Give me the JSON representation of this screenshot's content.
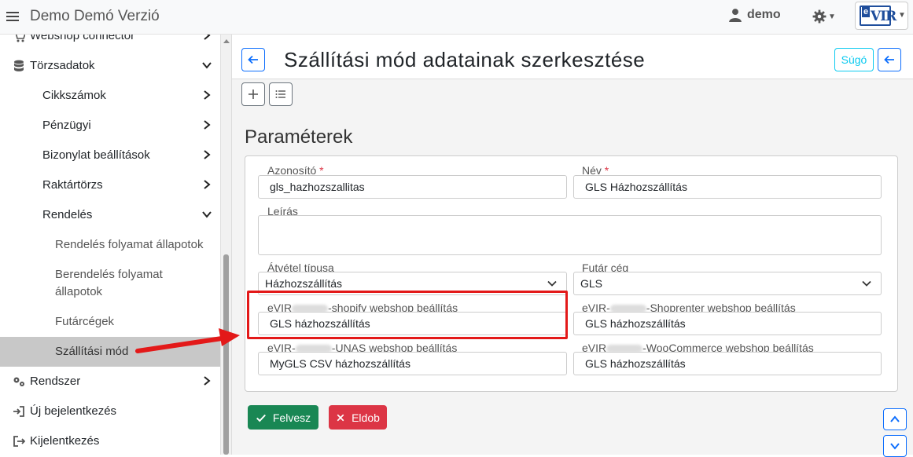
{
  "app": {
    "title": "Demo Demó Verzió"
  },
  "topbar": {
    "user": "demo",
    "logo": {
      "e": "e",
      "vir": "VIR"
    }
  },
  "sidebar": {
    "items": [
      {
        "label": "Webshop connector"
      },
      {
        "label": "Törzsadatok"
      },
      {
        "label": "Cikkszámok"
      },
      {
        "label": "Pénzügyi"
      },
      {
        "label": "Bizonylat beállítások"
      },
      {
        "label": "Raktártörzs"
      },
      {
        "label": "Rendelés"
      },
      {
        "label": "Rendelés folyamat állapotok"
      },
      {
        "label": "Berendelés folyamat állapotok"
      },
      {
        "label": "Futárcégek"
      },
      {
        "label": "Szállítási mód"
      },
      {
        "label": "Rendszer"
      },
      {
        "label": "Új bejelentkezés"
      },
      {
        "label": "Kijelentkezés"
      }
    ]
  },
  "header": {
    "title": "Szállítási mód adatainak szerkesztése",
    "help_label": "Súgó"
  },
  "section": {
    "title": "Paraméterek"
  },
  "form": {
    "azonosito": {
      "label": "Azonosító",
      "required": "*",
      "value": "gls_hazhozszallitas"
    },
    "nev": {
      "label": "Név",
      "required": "*",
      "value": "GLS Házhozszállítás"
    },
    "leiras": {
      "label": "Leírás",
      "value": ""
    },
    "atvetel": {
      "label": "Átvétel típusa",
      "value": "Házhozszállítás"
    },
    "futar": {
      "label": "Futár cég",
      "value": "GLS"
    },
    "shopify": {
      "label_prefix": "eVIR",
      "label_suffix": "-shopify webshop beállítás",
      "value": "GLS házhozszállítás"
    },
    "shoprenter": {
      "label_prefix": "eVIR-",
      "label_suffix": "-Shoprenter webshop beállítás",
      "value": "GLS házhozszállítás"
    },
    "unas": {
      "label_prefix": "eVIR-",
      "label_suffix": "-UNAS webshop beállítás",
      "value": "MyGLS CSV házhozszállítás"
    },
    "woocommerce": {
      "label_prefix": "eVIR",
      "label_suffix": "-WooCommerce webshop beállítás",
      "value": "GLS házhozszállítás"
    }
  },
  "actions": {
    "save_label": "Felvesz",
    "cancel_label": "Eldob"
  },
  "colors": {
    "primary": "#0d6efd",
    "success": "#198754",
    "danger": "#dc3545",
    "info": "#0dcaf0",
    "highlight": "#e31919"
  }
}
